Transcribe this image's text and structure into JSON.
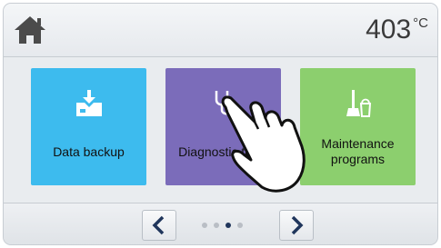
{
  "header": {
    "home_icon": "home-icon",
    "temperature_value": "403",
    "temperature_unit": "°C"
  },
  "tiles": [
    {
      "label": "Data backup",
      "icon": "data-backup-icon",
      "color": "#3dbbee"
    },
    {
      "label": "Diagnostic tests",
      "icon": "stethoscope-icon",
      "color": "#7b6cba"
    },
    {
      "label": "Maintenance programs",
      "icon": "broom-bucket-icon",
      "color": "#8ccf6e"
    }
  ],
  "pager": {
    "prev_icon": "chevron-left-icon",
    "next_icon": "chevron-right-icon",
    "page_count": 4,
    "current_page": 3,
    "accent": "#20365c"
  },
  "overlay": {
    "icon": "pointing-hand-icon"
  }
}
